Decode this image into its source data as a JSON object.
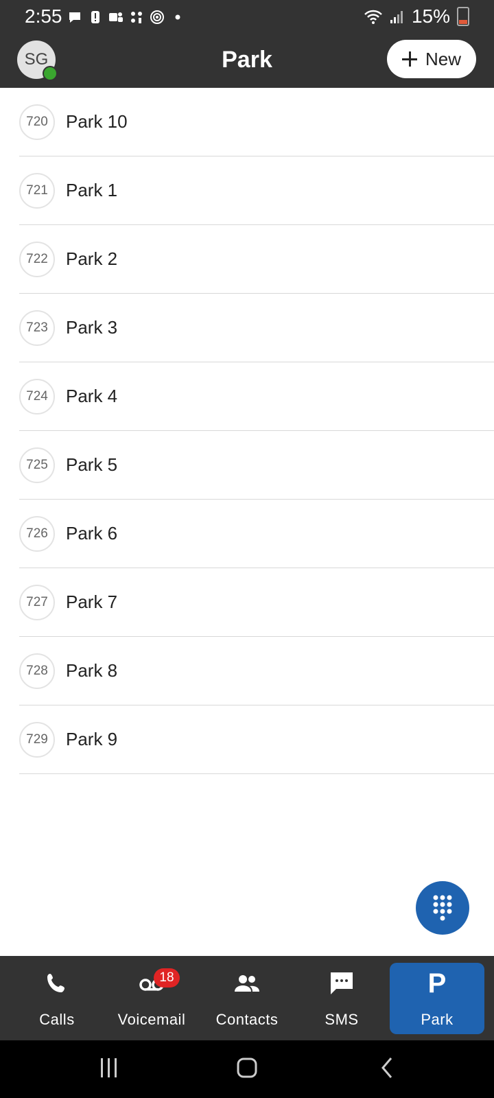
{
  "status_bar": {
    "time": "2:55",
    "battery": "15%"
  },
  "header": {
    "avatar_initials": "SG",
    "title": "Park",
    "new_label": "New"
  },
  "park_items": [
    {
      "ext": "720",
      "label": "Park 10"
    },
    {
      "ext": "721",
      "label": "Park 1"
    },
    {
      "ext": "722",
      "label": "Park 2"
    },
    {
      "ext": "723",
      "label": "Park 3"
    },
    {
      "ext": "724",
      "label": "Park 4"
    },
    {
      "ext": "725",
      "label": "Park 5"
    },
    {
      "ext": "726",
      "label": "Park 6"
    },
    {
      "ext": "727",
      "label": "Park 7"
    },
    {
      "ext": "728",
      "label": "Park 8"
    },
    {
      "ext": "729",
      "label": "Park 9"
    }
  ],
  "bottom_nav": {
    "items": [
      {
        "label": "Calls",
        "icon": "phone-icon"
      },
      {
        "label": "Voicemail",
        "icon": "voicemail-icon",
        "badge": "18"
      },
      {
        "label": "Contacts",
        "icon": "contacts-icon"
      },
      {
        "label": "SMS",
        "icon": "sms-icon"
      },
      {
        "label": "Park",
        "icon": "park-icon",
        "glyph": "P",
        "active": true
      }
    ]
  },
  "colors": {
    "bar": "#333333",
    "accent": "#1f63b0",
    "badge": "#e02424",
    "presence": "#3aa62f"
  }
}
